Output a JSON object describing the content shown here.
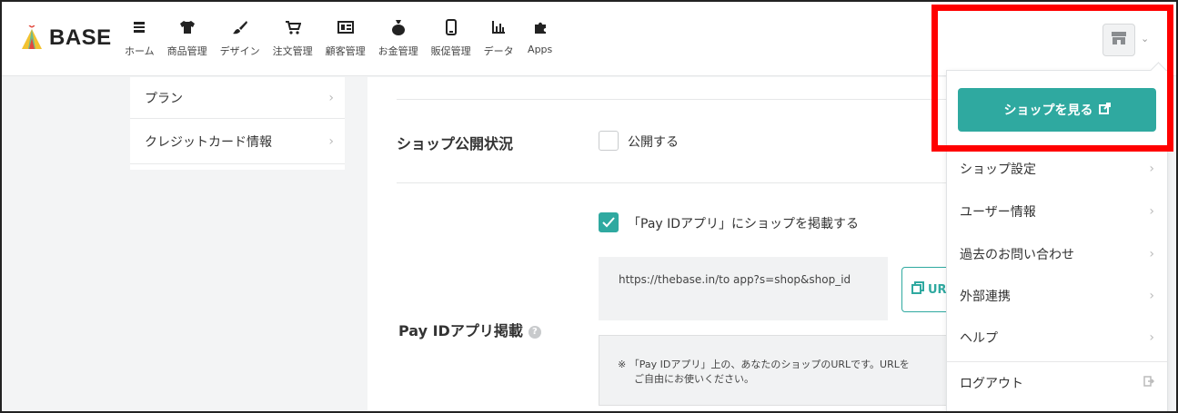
{
  "brand": {
    "name": "BASE"
  },
  "nav": [
    {
      "label": "ホーム",
      "icon": "list-icon"
    },
    {
      "label": "商品管理",
      "icon": "tshirt-icon"
    },
    {
      "label": "デザイン",
      "icon": "brush-icon"
    },
    {
      "label": "注文管理",
      "icon": "cart-icon"
    },
    {
      "label": "顧客管理",
      "icon": "customer-card-icon"
    },
    {
      "label": "お金管理",
      "icon": "money-bag-icon"
    },
    {
      "label": "販促管理",
      "icon": "phone-icon"
    },
    {
      "label": "データ",
      "icon": "bar-chart-icon"
    },
    {
      "label": "Apps",
      "icon": "puzzle-icon"
    }
  ],
  "sidebar": {
    "items": [
      {
        "label": "プラン"
      },
      {
        "label": "クレジットカード情報"
      }
    ]
  },
  "main": {
    "shop_status_label": "ショップ公開状況",
    "publish_checkbox": {
      "label": "公開する",
      "checked": false
    },
    "payid_label": "Pay IDアプリ掲載",
    "payid_checkbox": {
      "label": "「Pay IDアプリ」にショップを掲載する",
      "checked": true
    },
    "url_text": "https://thebase.in/to  app?s=shop&shop_id",
    "copy_button_label": "URL",
    "note_line1": "※ 「Pay IDアプリ」上の、あなたのショップのURLです。URLを",
    "note_line2": "ご自由にお使いください。"
  },
  "dropdown": {
    "view_shop_label": "ショップを見る",
    "items": [
      {
        "label": "ショップ設定"
      },
      {
        "label": "ユーザー情報"
      },
      {
        "label": "過去のお問い合わせ"
      },
      {
        "label": "外部連携"
      },
      {
        "label": "ヘルプ"
      }
    ],
    "logout_label": "ログアウト"
  },
  "colors": {
    "accent": "#2fa9a0",
    "highlight": "#ff0000"
  }
}
